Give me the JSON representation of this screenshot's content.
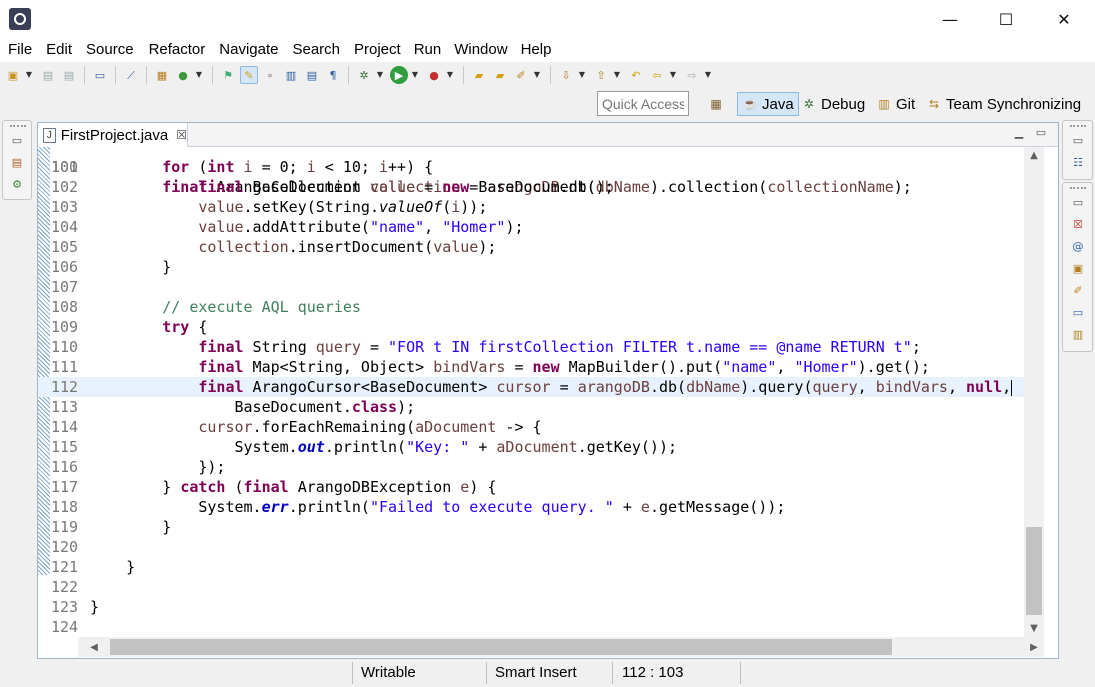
{
  "titlebar": {
    "minimize_glyph": "—",
    "maximize_glyph": "☐",
    "close_glyph": "✕"
  },
  "menu": [
    "File",
    "Edit",
    "Source",
    "Refactor",
    "Navigate",
    "Search",
    "Project",
    "Run",
    "Window",
    "Help"
  ],
  "quick_access": {
    "placeholder": "Quick Access"
  },
  "perspectives": {
    "java": "Java",
    "debug": "Debug",
    "git": "Git",
    "team": "Team Synchronizing"
  },
  "editor": {
    "tab_title": "FirstProject.java",
    "tab_close": "☒",
    "lines": [
      {
        "n": "101",
        "html": "        <span class=\"kw\">for</span> (<span class=\"kw\">int</span> <span class=\"var\">i</span> = 0; <span class=\"var\">i</span> &lt; 10; <span class=\"var\">i</span>++) {"
      },
      {
        "n": "102",
        "html": "            <span class=\"kw\">final</span> BaseDocument <span class=\"var\">value</span> = <span class=\"kw\">new</span> BaseDocument();"
      },
      {
        "n": "103",
        "html": "            <span class=\"var\">value</span>.setKey(String.<span class=\"st\">valueOf</span>(<span class=\"var\">i</span>));"
      },
      {
        "n": "104",
        "html": "            <span class=\"var\">value</span>.addAttribute(<span class=\"str\">\"name\"</span>, <span class=\"str\">\"Homer\"</span>);"
      },
      {
        "n": "105",
        "html": "            <span class=\"var\">collection</span>.insertDocument(<span class=\"var\">value</span>);"
      },
      {
        "n": "106",
        "html": "        }"
      },
      {
        "n": "107",
        "html": ""
      },
      {
        "n": "108",
        "html": "        <span class=\"cm\">// execute AQL queries</span>"
      },
      {
        "n": "109",
        "html": "        <span class=\"kw\">try</span> {"
      },
      {
        "n": "110",
        "html": "            <span class=\"kw\">final</span> String <span class=\"var\">query</span> = <span class=\"str\">\"FOR t IN firstCollection FILTER t.name == @name RETURN t\"</span>;"
      },
      {
        "n": "111",
        "html": "            <span class=\"kw\">final</span> Map&lt;String, Object&gt; <span class=\"var\">bindVars</span> = <span class=\"kw\">new</span> MapBuilder().put(<span class=\"str\">\"name\"</span>, <span class=\"str\">\"Homer\"</span>).get();"
      },
      {
        "n": "112",
        "html": "            <span class=\"kw\">final</span> ArangoCursor&lt;BaseDocument&gt; <span class=\"var\">cursor</span> = <span class=\"var\">arangoDB</span>.db(<span class=\"var\">dbName</span>).query(<span class=\"var\">query</span>, <span class=\"var\">bindVars</span>, <span class=\"kw\">null</span>,<span class=\"caret\"></span>",
        "current": true
      },
      {
        "n": "113",
        "html": "                BaseDocument.<span class=\"kw\">class</span>);"
      },
      {
        "n": "114",
        "html": "            <span class=\"var\">cursor</span>.forEachRemaining(<span class=\"var\">aDocument</span> -&gt; {"
      },
      {
        "n": "115",
        "html": "                System.<span class=\"fld\">out</span>.println(<span class=\"str\">\"Key: \"</span> + <span class=\"var\">aDocument</span>.getKey());"
      },
      {
        "n": "116",
        "html": "            });"
      },
      {
        "n": "117",
        "html": "        } <span class=\"kw\">catch</span> (<span class=\"kw\">final</span> ArangoDBException <span class=\"var\">e</span>) {"
      },
      {
        "n": "118",
        "html": "            System.<span class=\"fld\">err</span>.println(<span class=\"str\">\"Failed to execute query. \"</span> + <span class=\"var\">e</span>.getMessage());"
      },
      {
        "n": "119",
        "html": "        }"
      },
      {
        "n": "120",
        "html": ""
      },
      {
        "n": "121",
        "html": "    }"
      },
      {
        "n": "122",
        "html": ""
      },
      {
        "n": "123",
        "html": "}"
      },
      {
        "n": "124",
        "html": ""
      }
    ],
    "partial_top_line": "        <span class=\"kw\">final</span> ArangoCollection <span class=\"var\">collection</span> = <span class=\"var\">arangoDB</span>.db(<span class=\"var\">dbName</span>).collection(<span class=\"var\">collectionName</span>);"
  },
  "status": {
    "writable": "Writable",
    "insert_mode": "Smart Insert",
    "position": "112 : 103"
  },
  "colors": {
    "keyword": "#7f0055",
    "string": "#2a00ff",
    "comment": "#3f7f5f",
    "local_variable": "#6a3e3e",
    "current_line": "#e8f2fe"
  }
}
